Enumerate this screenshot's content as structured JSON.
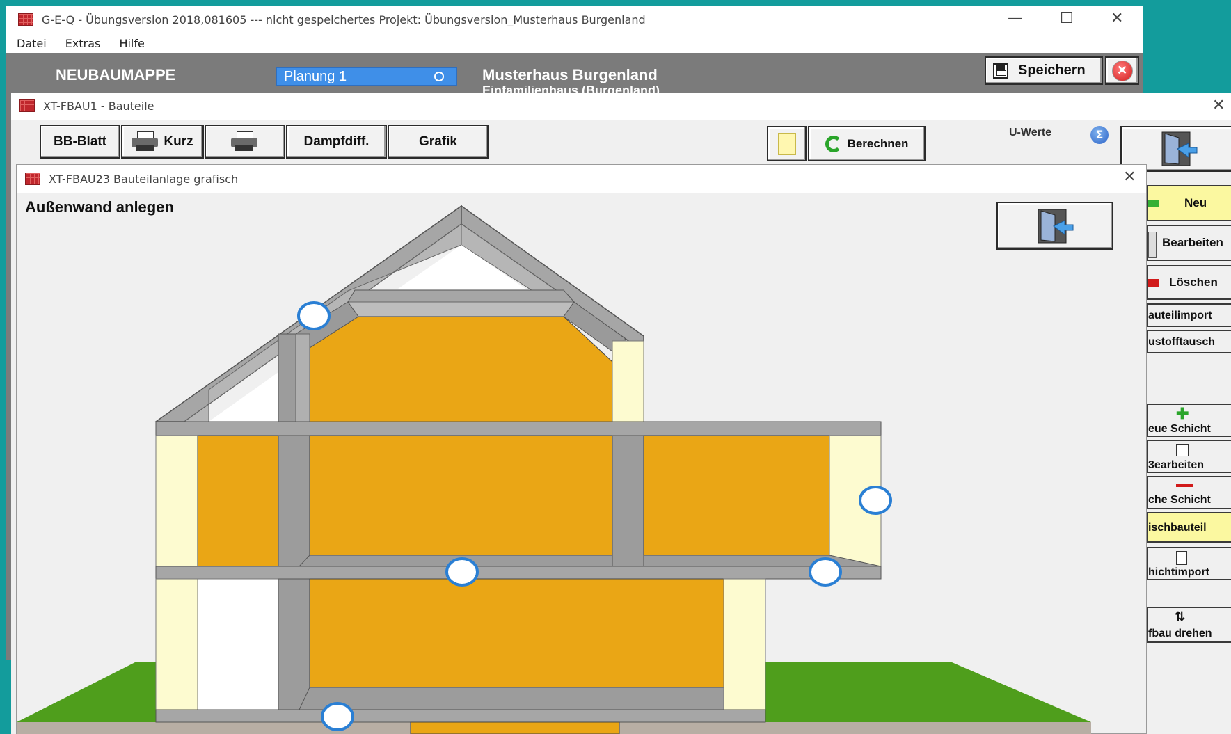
{
  "main_window": {
    "title": "G-E-Q - Übungsversion 2018,081605  ---  nicht gespeichertes Projekt: Übungsversion_Musterhaus Burgenland",
    "menu": [
      "Datei",
      "Extras",
      "Hilfe"
    ],
    "section_label": "NEUBAUMAPPE",
    "planung_value": "Planung 1",
    "project_name": "Musterhaus Burgenland",
    "project_sub": "Einfamilienhaus (Burgenland)",
    "save_label": "Speichern"
  },
  "bauteile_window": {
    "title": "XT-FBAU1 - Bauteile",
    "toolbar": {
      "bb_blatt": "BB-Blatt",
      "kurz": "Kurz",
      "dampfdiff": "Dampfdiff.",
      "grafik": "Grafik",
      "berechnen": "Berechnen",
      "u_werte": "U-Werte"
    },
    "side_buttons": {
      "neu": "Neu",
      "bearbeiten": "Bearbeiten",
      "loeschen": "Löschen",
      "bauteilimport": "auteilimport",
      "baustofftausch": "ustofftausch",
      "neue_schicht": "eue Schicht",
      "schicht_bearbeiten": "3earbeiten",
      "loesche_schicht": "che Schicht",
      "mischbauteil": "ischbauteil",
      "schichtimport": "hichtimport",
      "aufbau_drehen": "fbau drehen"
    }
  },
  "grafik_window": {
    "title": "XT-FBAU23 Bauteilanlage grafisch",
    "heading": "Außenwand anlegen"
  },
  "colors": {
    "teal_desktop": "#139c9c",
    "app_gray": "#7b7b7b",
    "planung_blue": "#3f8fe8",
    "insulation_orange": "#eaa615",
    "concrete_gray": "#9c9c9c",
    "cream_wall": "#fdfbd0",
    "grass_green": "#4f9e1c",
    "marker_blue": "#2a7fd4"
  },
  "icons": [
    "app-brick-icon",
    "printer-icon",
    "refresh-arrow-icon",
    "sigma-icon",
    "door-exit-icon",
    "note-icon",
    "save-disk-icon",
    "close-red-icon"
  ]
}
